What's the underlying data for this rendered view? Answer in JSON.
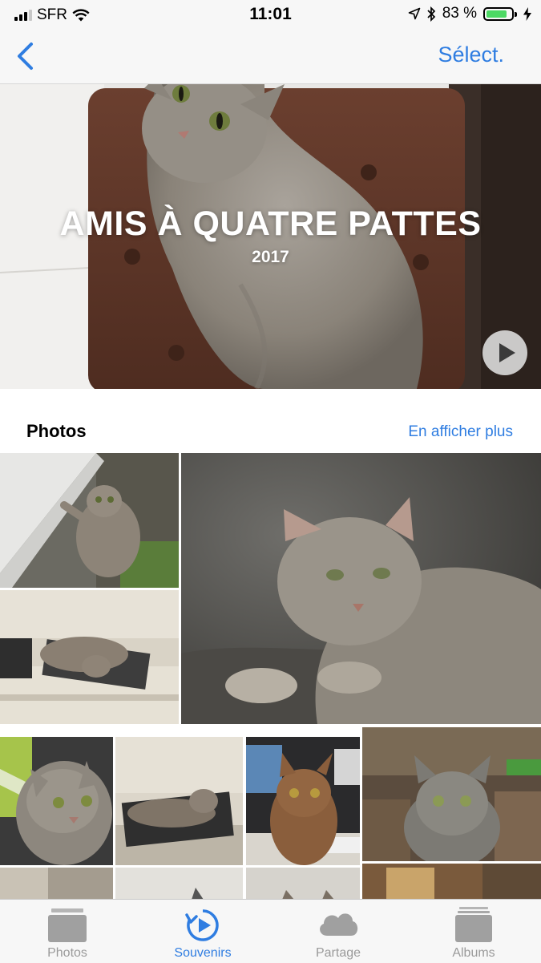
{
  "status_bar": {
    "carrier": "SFR",
    "time": "11:01",
    "battery_percent": "83 %",
    "battery_level": 0.83,
    "icons": [
      "signal-icon",
      "wifi-icon",
      "location-icon",
      "bluetooth-icon",
      "battery-icon",
      "charging-icon"
    ]
  },
  "nav": {
    "back_icon": "chevron-left-icon",
    "select_label": "Sélect."
  },
  "memory": {
    "title": "AMIS À QUATRE PATTES",
    "year": "2017",
    "play_icon": "play-icon"
  },
  "section": {
    "title": "Photos",
    "show_more": "En afficher plus"
  },
  "photos": [
    {
      "subject": "cat-on-window"
    },
    {
      "subject": "cat-lying-on-desk"
    },
    {
      "subject": "cat-close-up-large"
    },
    {
      "subject": "cat-portrait"
    },
    {
      "subject": "cat-on-chair"
    },
    {
      "subject": "ginger-cat"
    },
    {
      "subject": "grey-cat-portrait"
    },
    {
      "subject": "partial-photo"
    },
    {
      "subject": "partial-photo"
    },
    {
      "subject": "partial-photo"
    },
    {
      "subject": "partial-photo"
    }
  ],
  "tabs": [
    {
      "label": "Photos",
      "icon": "photos-stack-icon",
      "active": false
    },
    {
      "label": "Souvenirs",
      "icon": "memories-icon",
      "active": true
    },
    {
      "label": "Partage",
      "icon": "cloud-icon",
      "active": false
    },
    {
      "label": "Albums",
      "icon": "albums-icon",
      "active": false
    }
  ],
  "colors": {
    "accent": "#2f7de1",
    "tab_inactive": "#9a9a9a",
    "bars_background": "#f7f7f7"
  }
}
